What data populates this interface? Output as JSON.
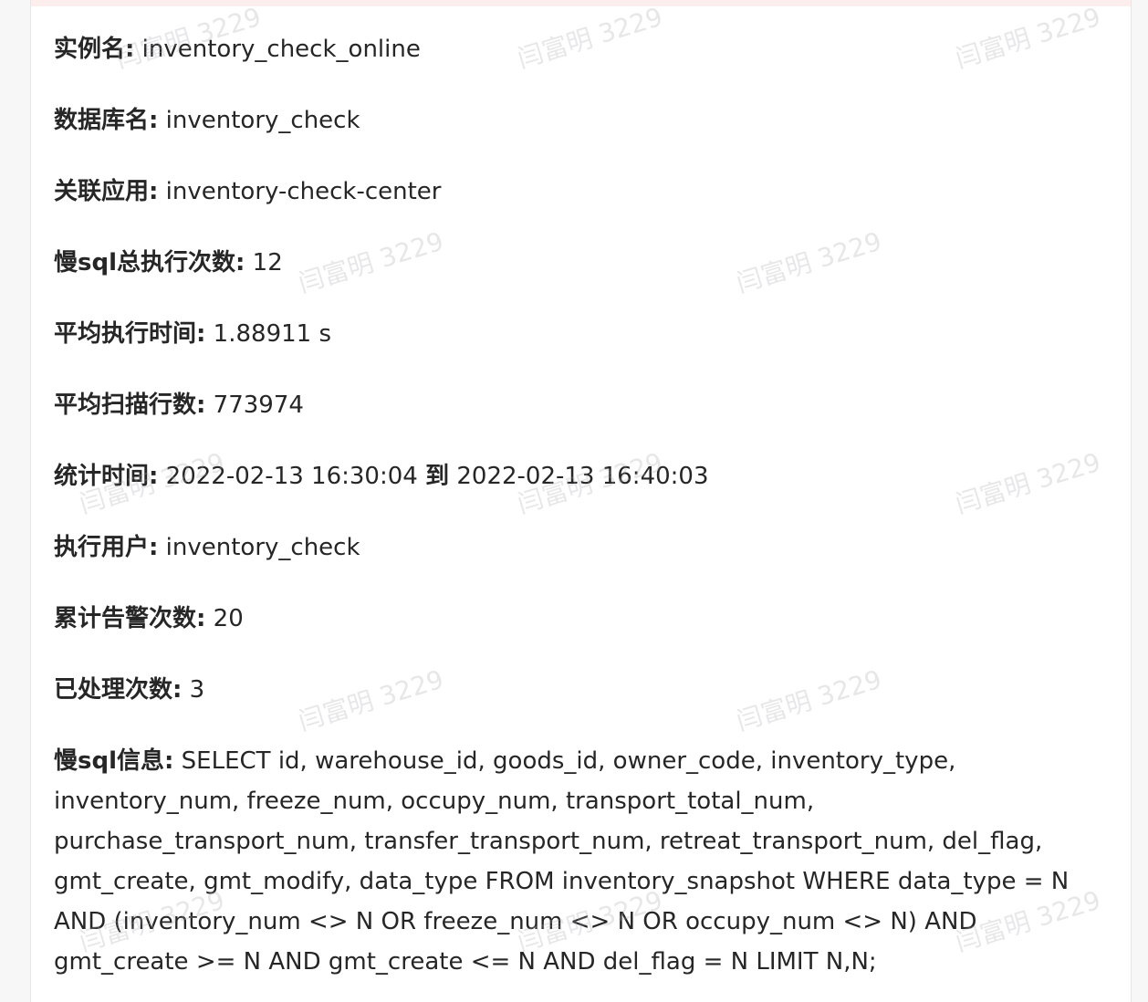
{
  "fields": [
    {
      "label": "实例名:",
      "value": "inventory_check_online"
    },
    {
      "label": "数据库名:",
      "value": "inventory_check"
    },
    {
      "label": "关联应用:",
      "value": "inventory-check-center"
    },
    {
      "label": "慢sql总执行次数:",
      "value": "12"
    },
    {
      "label": "平均执行时间:",
      "value": "1.88911 s"
    },
    {
      "label": "平均扫描行数:",
      "value": "773974"
    },
    {
      "label": "统计时间:",
      "value_start": "2022-02-13 16:30:04",
      "sep": "到",
      "value_end": "2022-02-13 16:40:03"
    },
    {
      "label": "执行用户:",
      "value": "inventory_check"
    },
    {
      "label": "累计告警次数:",
      "value": "20"
    },
    {
      "label": "已处理次数:",
      "value": "3"
    }
  ],
  "sql": {
    "label": "慢sql信息:",
    "value": "SELECT id, warehouse_id, goods_id, owner_code, inventory_type, inventory_num, freeze_num, occupy_num, transport_total_num, purchase_transport_num, transfer_transport_num, retreat_transport_num, del_flag, gmt_create, gmt_modify, data_type FROM inventory_snapshot WHERE data_type = N AND (inventory_num <> N OR freeze_num <> N OR occupy_num <> N) AND gmt_create >= N AND gmt_create <= N AND del_flag = N LIMIT N,N;"
  },
  "watermark": {
    "text": "闫富明 3229"
  }
}
